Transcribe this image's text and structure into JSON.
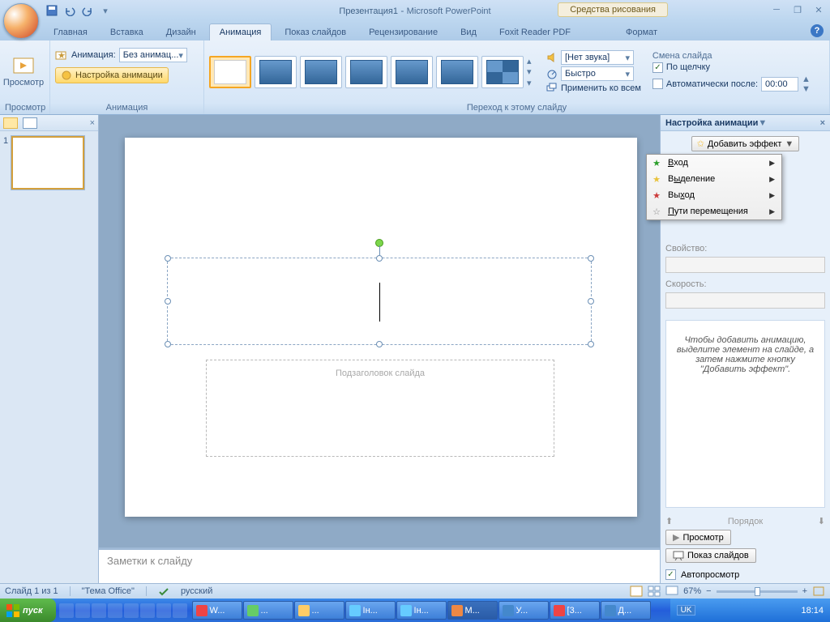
{
  "title": {
    "doc": "Презентация1",
    "app": "Microsoft PowerPoint",
    "context_tools": "Средства рисования"
  },
  "tabs": {
    "home": "Главная",
    "insert": "Вставка",
    "design": "Дизайн",
    "animation": "Анимация",
    "slideshow": "Показ слайдов",
    "review": "Рецензирование",
    "view": "Вид",
    "foxit": "Foxit Reader PDF",
    "format": "Формат"
  },
  "ribbon": {
    "preview_group": "Просмотр",
    "preview_btn": "Просмотр",
    "anim_group": "Анимация",
    "anim_label": "Анимация:",
    "anim_value": "Без анимац...",
    "anim_setup": "Настройка анимации",
    "trans_group": "Переход к этому слайду",
    "sound_label": "[Нет звука]",
    "speed_label": "Быстро",
    "apply_all": "Применить ко всем",
    "advance_group": "Смена слайда",
    "on_click": "По щелчку",
    "auto_after": "Автоматически после:",
    "auto_time": "00:00"
  },
  "slide": {
    "subtitle_placeholder": "Подзаголовок слайда",
    "notes_placeholder": "Заметки к слайду"
  },
  "taskpane": {
    "title": "Настройка анимации",
    "add_effect": "Добавить эффект",
    "menu": {
      "entrance": "Вход",
      "emphasis": "Выделение",
      "exit": "Выход",
      "motion": "Пути перемещения"
    },
    "modify_label": "Свойство:",
    "speed_label": "Скорость:",
    "hint": "Чтобы добавить анимацию, выделите элемент на слайде, а затем нажмите кнопку \"Добавить эффект\".",
    "order": "Порядок",
    "play": "Просмотр",
    "slideshow": "Показ слайдов",
    "autopreview": "Автопросмотр"
  },
  "status": {
    "slide_of": "Слайд 1 из 1",
    "theme": "\"Тема Office\"",
    "lang": "русский",
    "zoom": "67%"
  },
  "taskbar": {
    "start": "пуск",
    "items": [
      "W...",
      "...",
      "...",
      "Ін...",
      "Ін...",
      "М...",
      "У...",
      "[3...",
      "Д..."
    ],
    "lang": "UK",
    "time": "18:14"
  }
}
